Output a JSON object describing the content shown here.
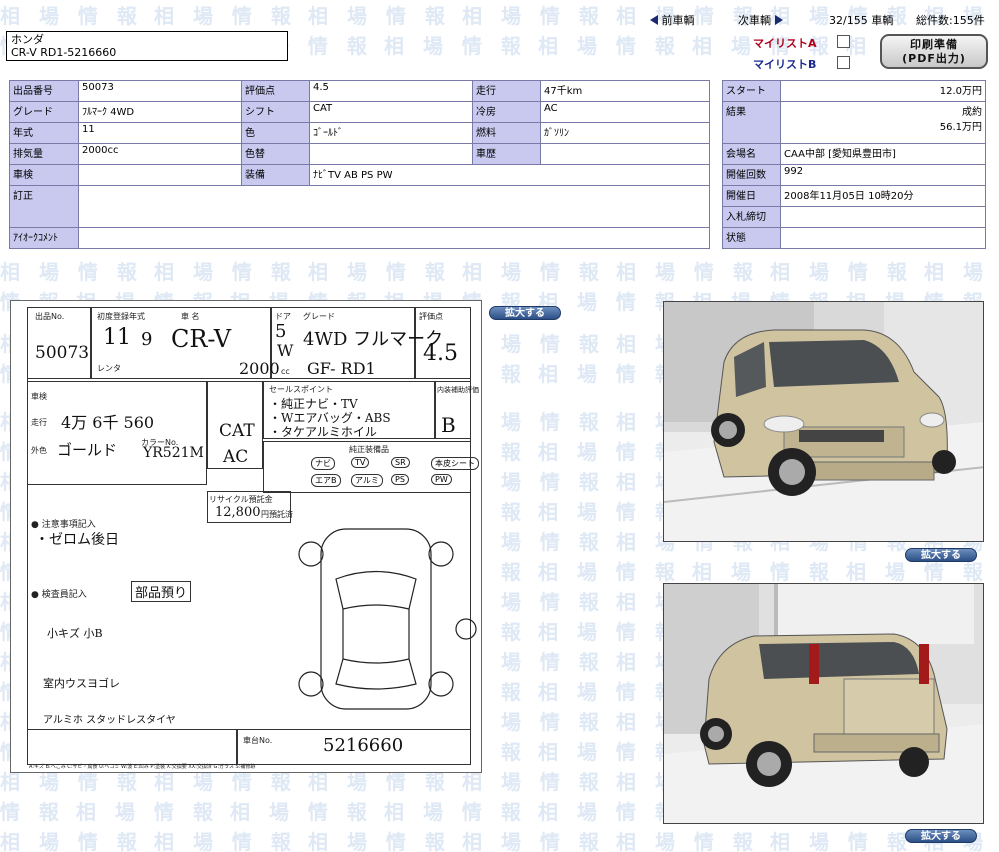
{
  "watermark": {
    "text": "相 場 情 報"
  },
  "header": {
    "maker": "ホンダ",
    "model_line": "CR-V RD1-5216660",
    "nav": {
      "prev_label": "前車輌",
      "next_label": "次車輌",
      "position": "32/155 車輌",
      "total": "総件数:155件"
    },
    "mylist_a": "マイリストA",
    "mylist_b": "マイリストB",
    "print_button_line1": "印刷準備",
    "print_button_line2": "(PDF出力)"
  },
  "info": {
    "lot_label": "出品番号",
    "lot": "50073",
    "score_label": "評価点",
    "score": "4.5",
    "mileage_label": "走行",
    "mileage": "47千km",
    "grade_label": "グレード",
    "grade": "ﾌﾙﾏｰｸ 4WD",
    "shift_label": "シフト",
    "shift": "CAT",
    "ac_label": "冷房",
    "ac": "AC",
    "year_label": "年式",
    "year": "11",
    "color_label": "色",
    "color": "ｺﾞｰﾙﾄﾞ",
    "fuel_label": "燃料",
    "fuel": "ｶﾞｿﾘﾝ",
    "displacement_label": "排気量",
    "displacement": "2000cc",
    "color_change_label": "色替",
    "color_change": "",
    "history_label": "車歴",
    "history": "",
    "inspection_label": "車検",
    "inspection": "",
    "equipment_label": "装備",
    "equipment": "ﾅﾋﾞTV AB PS PW",
    "correction_label": "訂正",
    "correction": "",
    "comment_label": "ｱｲｵｰｸｺﾒﾝﾄ",
    "comment": ""
  },
  "side": {
    "start_label": "スタート",
    "start": "12.0万円",
    "result_label": "結果",
    "result_status": "成約",
    "result_price": "56.1万円",
    "venue_label": "会場名",
    "venue": "CAA中部 [愛知県豊田市]",
    "session_label": "開催回数",
    "session": "992",
    "date_label": "開催日",
    "date": "2008年11月05日 10時20分",
    "deadline_label": "入札締切",
    "deadline": "",
    "status_label": "状態",
    "status": ""
  },
  "sheet": {
    "lot_no_label": "出品No.",
    "lot_no": "50073",
    "first_reg_label": "初度登録年式",
    "name_label": "車 名",
    "year_hw": "11",
    "month_hw": "9",
    "name_hw": "CR-V",
    "doors_label": "ドア",
    "doors_hw": "5",
    "body_hw": "W",
    "grade_label": "グレード",
    "grade_hw": "4WD フルマーク",
    "score_label": "評価点",
    "score_hw": "4.5",
    "rental_label": "レンタ",
    "cc_hw": "2000",
    "cc_unit": "cc",
    "type_hw": "GF-  RD1",
    "inspection_label": "車検",
    "mileage_label": "走行",
    "mileage_hw": "4万 6千 560",
    "exterior_label": "外色",
    "exterior_hw": "ゴールド",
    "color_no_label": "カラーNo.",
    "color_no_hw": "YR521M",
    "shift_hw": "CAT",
    "ac_hw": "AC",
    "sales_points_label": "セールスポイント",
    "sales_hw_1": "・純正ナビ・TV",
    "sales_hw_2": "・Wエアバッグ・ABS",
    "sales_hw_3": "・タケアルミホイル",
    "interior_label": "内装補助評価",
    "interior_hw": "B",
    "eq_label": "純正装備品",
    "eq_items": [
      "ナビ",
      "TV",
      "SR",
      "本皮シート",
      "エアB",
      "アルミ",
      "PS",
      "PW"
    ],
    "recycle_label": "リサイクル預託金",
    "recycle_hw": "12,800",
    "recycle_unit": "円預託済",
    "note_label": "● 注意事項記入",
    "note_hw": "・ゼロム後日",
    "inspector_label": "● 検査員記入",
    "inspector_hw": "部品預り",
    "insp_note_1": "小キズ 小B",
    "insp_note_2": "室内ウスヨゴレ",
    "insp_note_3": "アルミホ スタッドレスタイヤ",
    "chassis_label": "車台No.",
    "chassis_hw": "5216660",
    "legend": "A:キズ B:へこみ C:サビ・腐食 U:ヘコミ W:波 E:凹み P:塗装 X:交換要 XX:交換済 G:ガラス S:補修跡"
  },
  "expand_label": "拡大する"
}
